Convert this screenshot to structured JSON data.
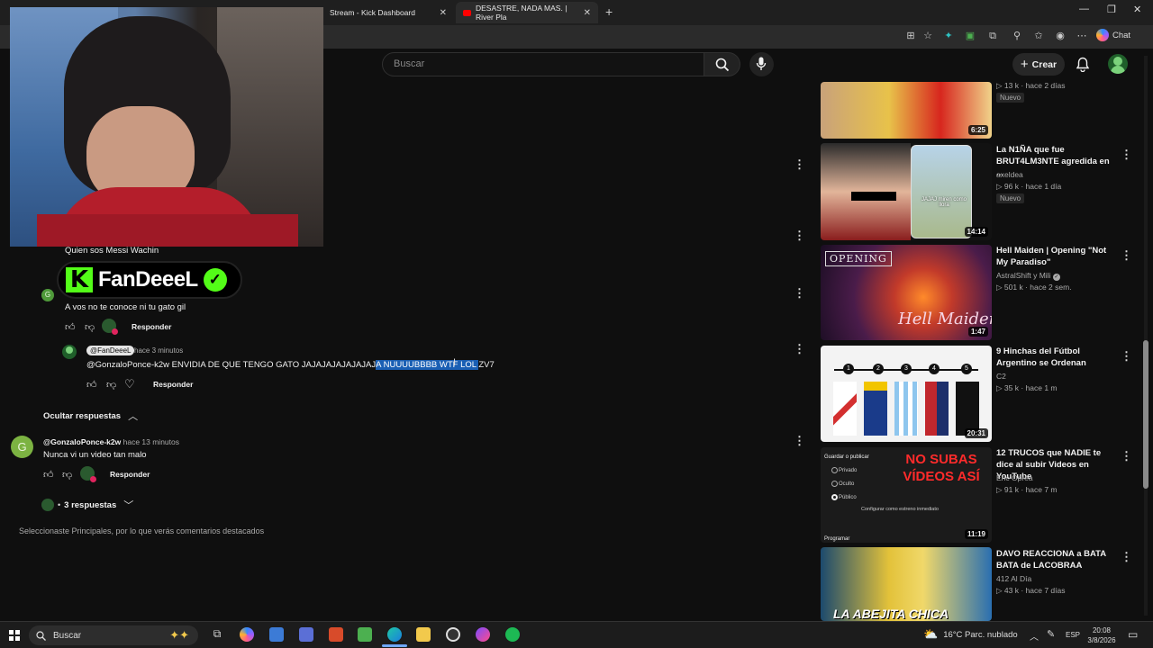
{
  "browser": {
    "tabs": [
      {
        "title": "Stream - Kick Dashboard"
      },
      {
        "title": "DESASTRE, NADA MAS. | River Pla"
      }
    ],
    "chat_label": "Chat"
  },
  "header": {
    "search_placeholder": "Buscar",
    "create_label": "Crear"
  },
  "comments": {
    "partial_text": "Quien sos Messi Wachin",
    "banner_text": "FanDeeeL",
    "reply1_text": "A vos no te conoce ni tu gato gil",
    "reply_label": "Responder",
    "reply2": {
      "author": "@FanDeeeL",
      "time": "hace 3 minutos",
      "text_pre": "@GonzaloPonce-k2w ENVIDIA DE QUE TENGO GATO JAJAJAJAJAJAJAJ",
      "text_sel": "A NUUUUBBBB WTF LOL ",
      "text_post": "ZV7"
    },
    "hide_replies": "Ocultar respuestas",
    "main": {
      "avatar_letter": "G",
      "author": "@GonzaloPonce-k2w",
      "time": "hace 13 minutos",
      "text": "Nunca vi un video tan malo",
      "replies_label": "3 respuestas"
    },
    "avatar_letter_small": "G",
    "footer": "Seleccionaste Principales, por lo que verás comentarios destacados"
  },
  "sidebar": {
    "videos": [
      {
        "title": "",
        "channel": "",
        "views": "13 k",
        "age": "hace 2 días",
        "badge": "Nuevo",
        "duration": "6:25"
      },
      {
        "title": "La N1ÑA que fue BRUT4LM3NTE agredida en ...",
        "channel": "axeldea",
        "views": "96 k",
        "age": "hace 1 día",
        "badge": "Nuevo",
        "duration": "14:14",
        "thumb_text": "JAJAJ miren como llora"
      },
      {
        "title": "Hell Maiden | Opening \"Not My Paradiso\"",
        "channel": "AstralShift y Mili",
        "views": "501 k",
        "age": "hace 2 sem.",
        "duration": "1:47",
        "thumb_text": "OPENING",
        "thumb_logo": "Hell Maiden"
      },
      {
        "title": "9 Hinchas del Fútbol Argentino se Ordenan",
        "channel": "C2",
        "views": "35 k",
        "age": "hace 1 m",
        "duration": "20:31",
        "thumb_numbers": [
          "1",
          "2",
          "3",
          "4",
          "5"
        ]
      },
      {
        "title": "12 TRUCOS que NADIE te dice al subir Videos en YouTube",
        "channel": "Eric Oprea",
        "views": "91 k",
        "age": "hace 7 m",
        "duration": "11:19",
        "thumb_heading": "Guardar o publicar",
        "thumb_options": [
          "Privado",
          "Oculto",
          "Público"
        ],
        "thumb_check": "Configurar como estreno inmediato",
        "thumb_footer": "Programar",
        "thumb_text": "NO SUBAS VÍDEOS ASÍ"
      },
      {
        "title": "DAVO REACCIONA a BATA BATA de LACOBRAA",
        "channel": "412 Al Día",
        "views": "43 k",
        "age": "hace 7 días",
        "thumb_text": "LA ABEJITA CHICA"
      }
    ]
  },
  "taskbar": {
    "search_label": "Buscar",
    "weather": "16°C  Parc. nublado",
    "lang": "ESP",
    "time": "20:08",
    "date": "3/8/2026"
  }
}
